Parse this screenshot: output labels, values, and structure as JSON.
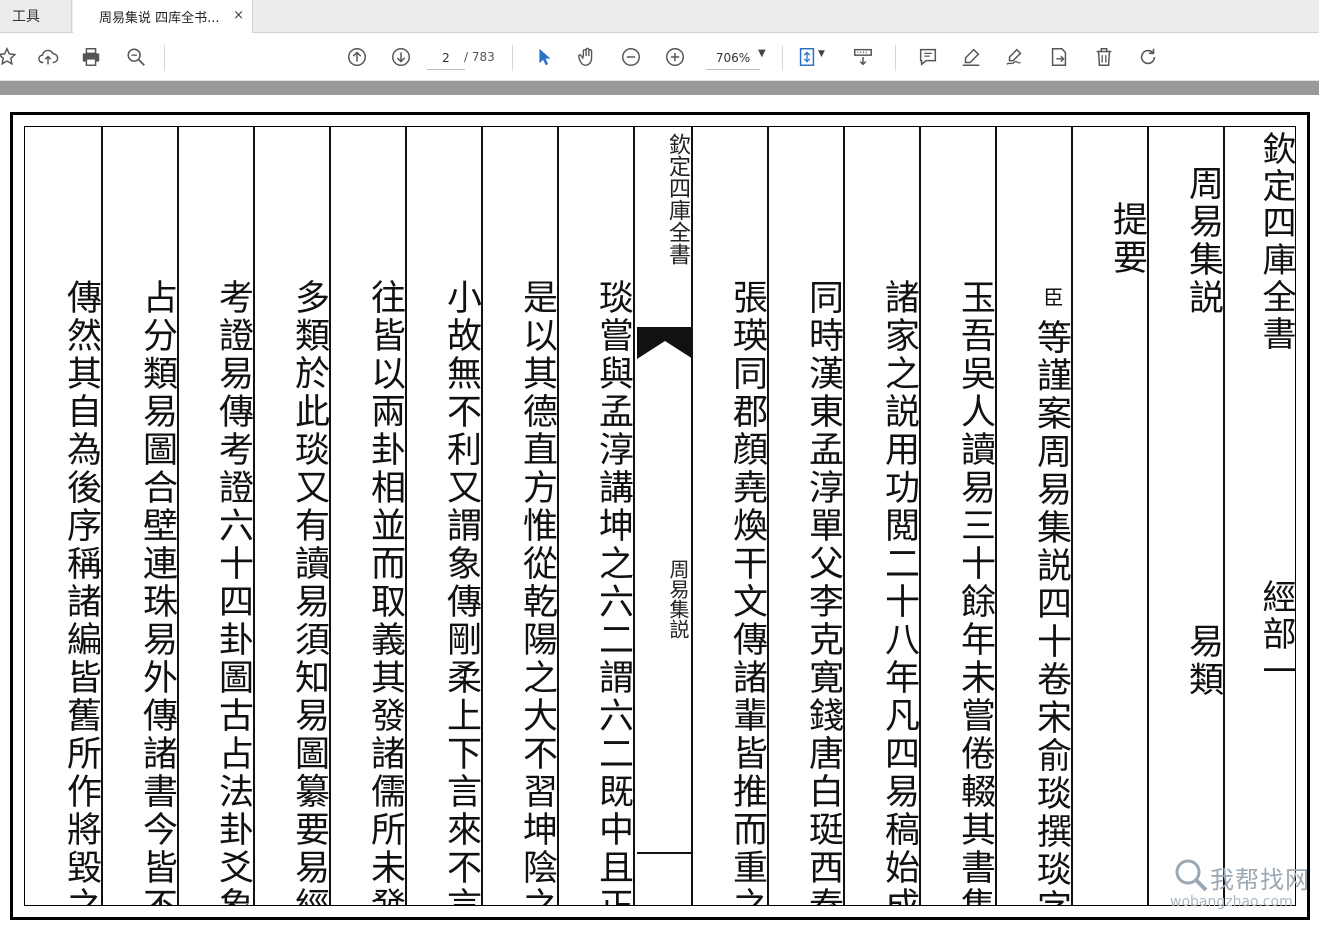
{
  "tabs": {
    "tools": "工具",
    "document": "周易集说 四库全书...",
    "close": "×"
  },
  "toolbar": {
    "page_current": "2",
    "page_total": "/ 783",
    "zoom": "706%"
  },
  "icons": [
    "star-icon",
    "upload-cloud-icon",
    "print-icon",
    "zoom-search-icon",
    "arrow-up-circle-icon",
    "arrow-down-circle-icon",
    "select-arrow-icon",
    "hand-icon",
    "zoom-out-icon",
    "zoom-in-icon",
    "fit-page-icon",
    "scroll-mode-icon",
    "comment-icon",
    "highlight-icon",
    "sign-icon",
    "share-icon",
    "delete-icon",
    "rotate-icon"
  ],
  "document": {
    "title_main": "欽定四庫全書",
    "title_section": "經部一",
    "book_title": "周易集説",
    "book_category": "易類",
    "heading": "提要",
    "minister_mark": "臣",
    "fold_top": "欽定四庫全書",
    "fold_bottom": "周易集説",
    "columns": [
      "等謹案周易集説四十卷宋俞琰撰琰字",
      "玉吾吳人讀易三十餘年未嘗倦輟其書集",
      "諸家之説用功閲二十八年凡四易稿始成",
      "同時漢東孟淳單父李克寛錢唐白珽西秦",
      "張瑛同郡顔堯煥干文傳諸輩皆推而重之",
      "琰嘗與孟淳講坤之六二謂六二既中且正",
      "是以其德直方惟從乾陽之大不習坤陰之",
      "小故無不利又謂象傳剛柔上下言來不言",
      "往皆以兩卦相並而取義其發諸儒所未發",
      "多類於此琰又有讀易須知易圖纂要易經",
      "考證易傳考證六十四卦圖古占法卦爻象",
      "占分類易圖合壁連珠易外傳諸書今皆不",
      "傳然其自為後序稱諸編皆舊所作將毀之"
    ]
  },
  "watermark": {
    "text": "我帮找网",
    "url": "wobangzhao.com"
  }
}
